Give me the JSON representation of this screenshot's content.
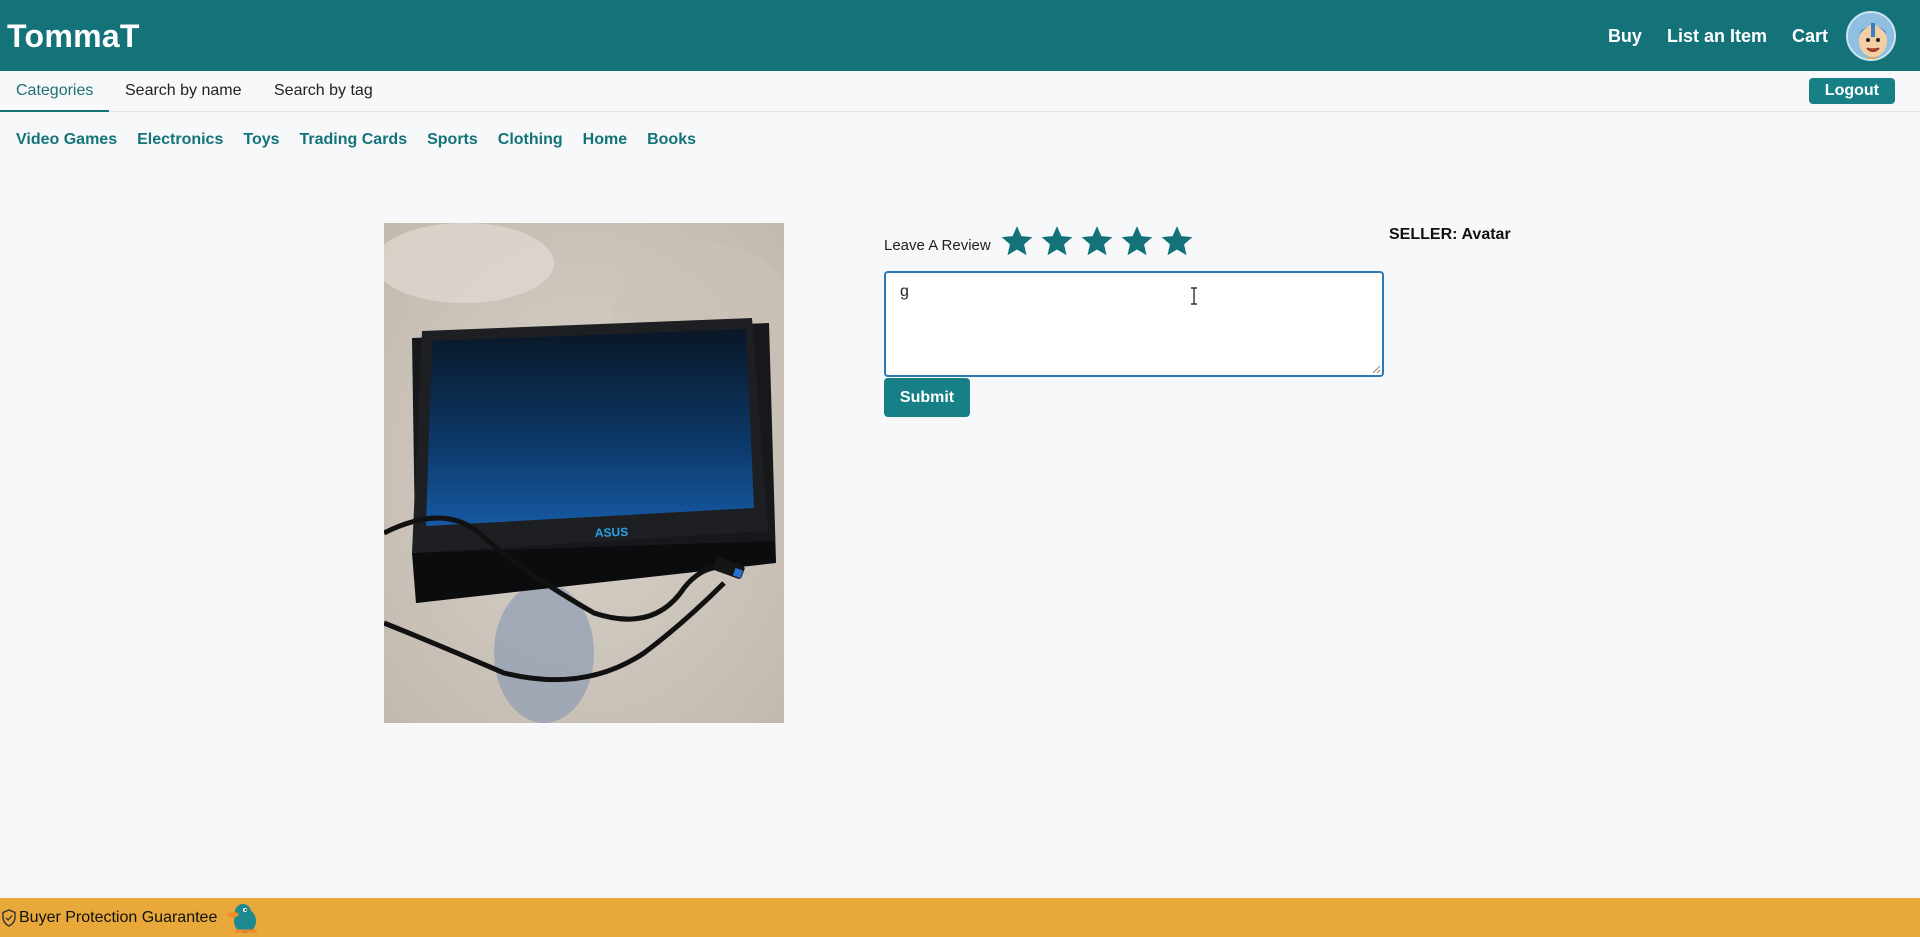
{
  "header": {
    "brand": "TommaT",
    "links": [
      "Buy",
      "List an Item",
      "Cart"
    ],
    "avatar_icon": "user-avatar"
  },
  "subnav": {
    "tabs": [
      "Categories",
      "Search by name",
      "Search by tag"
    ],
    "active_tab": "Categories",
    "logout_label": "Logout"
  },
  "categories": [
    "Video Games",
    "Electronics",
    "Toys",
    "Trading Cards",
    "Sports",
    "Clothing",
    "Home",
    "Books"
  ],
  "product": {
    "image_icon": "product-photo-laptop"
  },
  "review": {
    "label": "Leave A Review",
    "stars": 5,
    "text_value": "g",
    "submit_label": "Submit"
  },
  "seller": {
    "label": "SELLER:",
    "name": "Avatar"
  },
  "footer": {
    "text": "Buyer Protection Guarantee"
  },
  "colors": {
    "primary": "#137378",
    "accent": "#e8a83a",
    "background": "#f6f8fa"
  }
}
